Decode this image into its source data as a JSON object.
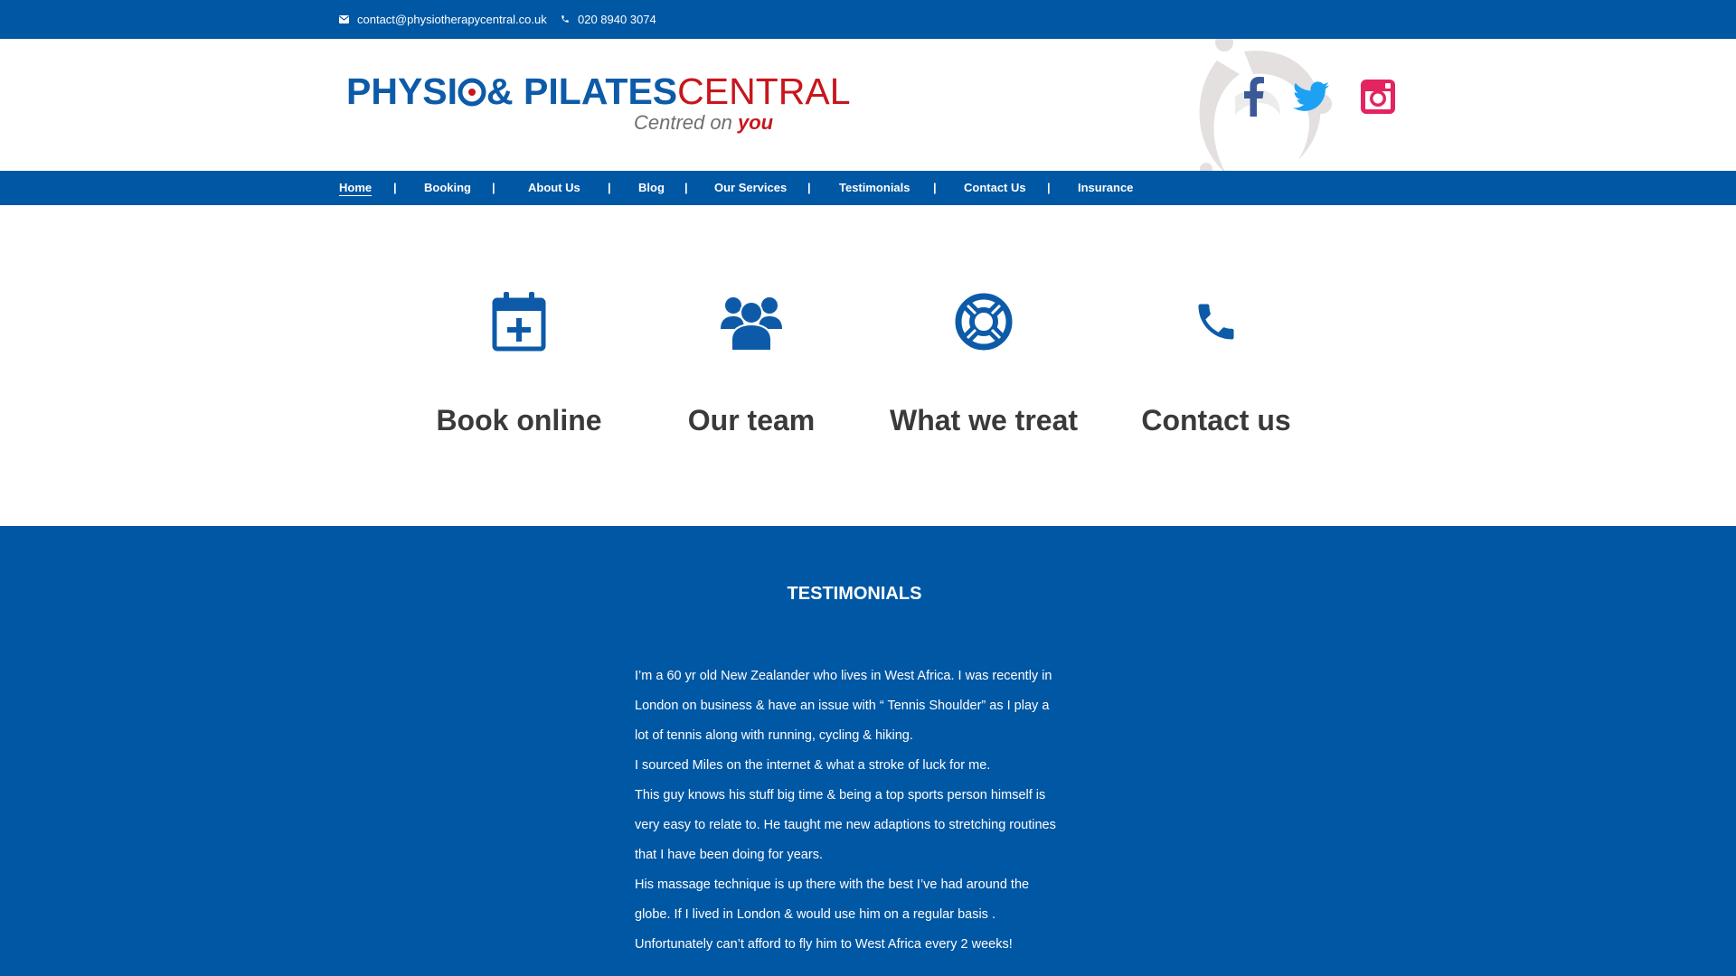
{
  "topbar": {
    "email": "contact@physiotherapycentral.co.uk",
    "phone": "020 8940 3074",
    "email_icon": "envelope-icon",
    "phone_icon": "phone-icon"
  },
  "logo": {
    "part1": "PHYSI",
    "part2": "& PILATES",
    "part3": "CENTRAL",
    "tagline": "Centred on ",
    "tagline_emphasis": "you"
  },
  "social": [
    "facebook-icon",
    "twitter-icon",
    "instagram-icon"
  ],
  "colors": {
    "brand_blue": "#0057a4",
    "logo_red": "#c8161d",
    "facebook": "#3b5998",
    "twitter": "#1da1f2",
    "instagram": "#e4245f"
  },
  "nav": {
    "items": [
      {
        "label": "Home",
        "active": true
      },
      {
        "label": "Booking"
      },
      {
        "label": "About Us"
      },
      {
        "label": "Blog"
      },
      {
        "label": "Our Services"
      },
      {
        "label": "Testimonials"
      },
      {
        "label": "Contact Us"
      },
      {
        "label": "Insurance"
      }
    ],
    "separator": "|"
  },
  "features": [
    {
      "label": "Book online",
      "icon": "calendar-plus-icon"
    },
    {
      "label": "Our team",
      "icon": "users-icon"
    },
    {
      "label": "What we treat",
      "icon": "lifebuoy-icon"
    },
    {
      "label": "Contact us",
      "icon": "phone-icon"
    }
  ],
  "testimonials": {
    "heading": "TESTIMONIALS",
    "lines": [
      "I’m a 60 yr old New Zealander who lives in West Africa. I was recently in",
      "London on business & have an issue with “ Tennis Shoulder” as I play a",
      "lot of tennis along with running, cycling & hiking.",
      "I sourced Miles on the internet & what a stroke of luck for me.",
      "This guy knows his stuff big time & being a top sports person himself is",
      "very easy to relate to. He taught me new adaptions to stretching routines",
      "that I have been doing for years.",
      "His massage technique is up there with the best I’ve had around the",
      "globe. If I lived in London & would use him on a regular basis .",
      "Unfortunately can’t afford to fly him to West Africa every 2 weeks!"
    ]
  }
}
